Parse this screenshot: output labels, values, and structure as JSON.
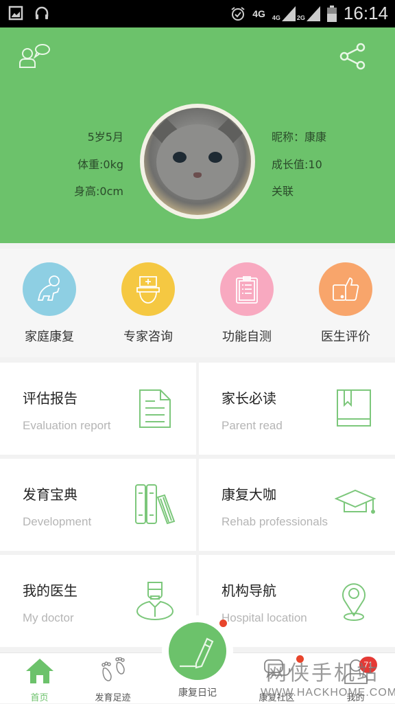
{
  "status_bar": {
    "left_icons": [
      "image-icon",
      "headphones-icon"
    ],
    "right_icons": [
      "alarm-icon",
      "network-4g-icon",
      "signal-4g-icon",
      "signal-2g-icon",
      "battery-icon"
    ],
    "net_primary": "4G",
    "net_sim1": "4G",
    "net_sim2": "2G",
    "time": "16:14"
  },
  "header": {
    "bg_color": "#6cc26b",
    "left_button_icon": "contacts-chat-icon",
    "right_button_icon": "share-icon",
    "profile": {
      "age": "5岁5月",
      "weight": "体重:0kg",
      "height": "身高:0cm",
      "nickname": "昵称：康康",
      "growth": "成长值:10",
      "link": "关联"
    }
  },
  "quick_actions": [
    {
      "label": "家庭康复",
      "icon": "crawling-baby-icon",
      "color": "#8ecfe3"
    },
    {
      "label": "专家咨询",
      "icon": "nurse-icon",
      "color": "#f5c842"
    },
    {
      "label": "功能自测",
      "icon": "clipboard-icon",
      "color": "#f8a9c0"
    },
    {
      "label": "医生评价",
      "icon": "thumbs-up-icon",
      "color": "#f8a56b"
    }
  ],
  "cards": [
    {
      "title": "评估报告",
      "subtitle": "Evaluation report",
      "icon": "document-icon"
    },
    {
      "title": "家长必读",
      "subtitle": "Parent read",
      "icon": "bookmark-book-icon"
    },
    {
      "title": "发育宝典",
      "subtitle": "Development",
      "icon": "books-icon"
    },
    {
      "title": "康复大咖",
      "subtitle": "Rehab professionals",
      "icon": "graduation-cap-icon"
    },
    {
      "title": "我的医生",
      "subtitle": "My doctor",
      "icon": "doctor-icon"
    },
    {
      "title": "机构导航",
      "subtitle": "Hospital location",
      "icon": "location-pin-icon"
    }
  ],
  "tabbar": {
    "tabs": [
      {
        "label": "首页",
        "icon": "home-icon",
        "active": true
      },
      {
        "label": "发育足迹",
        "icon": "footprints-icon",
        "active": false
      },
      {
        "label": "康复日记",
        "icon": "pencil-icon",
        "active": false
      },
      {
        "label": "康复社区",
        "icon": "chat-bubbles-icon",
        "active": false
      },
      {
        "label": "我的",
        "icon": "user-icon",
        "active": false
      }
    ],
    "badge_count": "71"
  },
  "watermark": {
    "text": "网侠手机站",
    "url_text": "WWW.HACKHOME.COM"
  }
}
